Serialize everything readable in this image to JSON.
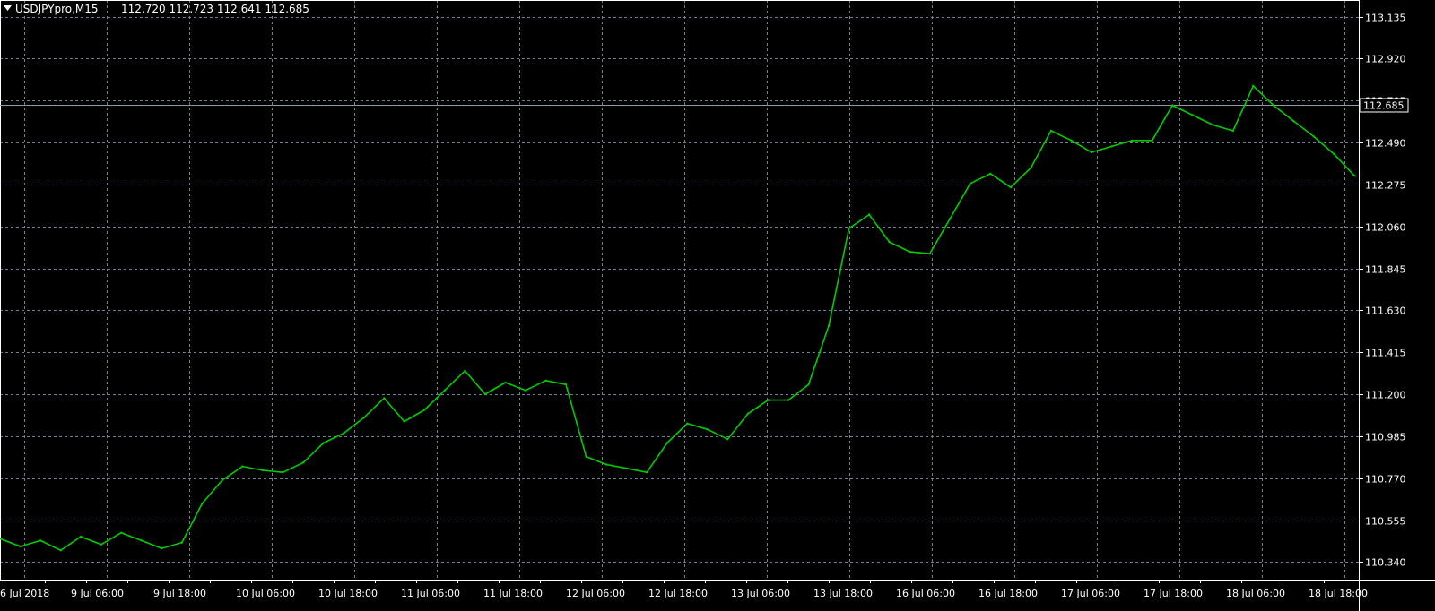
{
  "header": {
    "symbol": "USDJPYpro,M15",
    "ohlc": "112.720 112.723 112.641 112.685",
    "menu_icon": "triangle-down-icon"
  },
  "colors": {
    "background": "#000000",
    "series": "#00cc00",
    "grid": "#6e8094",
    "axis": "#ffffff",
    "current_price_line": "#8c9aa8"
  },
  "current_price": {
    "label": "112.685",
    "value": 112.685
  },
  "chart_data": {
    "type": "line",
    "title": "",
    "xlabel": "",
    "ylabel": "",
    "ylim": [
      110.25,
      113.22
    ],
    "grid": true,
    "y_ticks": [
      "113.135",
      "112.920",
      "112.705",
      "112.490",
      "112.275",
      "112.060",
      "111.845",
      "111.630",
      "111.415",
      "111.200",
      "110.985",
      "110.770",
      "110.555",
      "110.340"
    ],
    "x_ticks": [
      "6 Jul 2018",
      "9 Jul 06:00",
      "9 Jul 18:00",
      "10 Jul 06:00",
      "10 Jul 18:00",
      "11 Jul 06:00",
      "11 Jul 18:00",
      "12 Jul 06:00",
      "12 Jul 18:00",
      "13 Jul 06:00",
      "13 Jul 18:00",
      "16 Jul 06:00",
      "16 Jul 18:00",
      "17 Jul 06:00",
      "17 Jul 18:00",
      "18 Jul 06:00",
      "18 Jul 18:00"
    ],
    "series": [
      {
        "values": [
          110.46,
          110.42,
          110.45,
          110.4,
          110.47,
          110.43,
          110.49,
          110.45,
          110.41,
          110.44,
          110.64,
          110.76,
          110.83,
          110.81,
          110.8,
          110.85,
          110.95,
          111.0,
          111.08,
          111.18,
          111.06,
          111.12,
          111.22,
          111.32,
          111.2,
          111.26,
          111.22,
          111.27,
          111.25,
          110.88,
          110.84,
          110.82,
          110.8,
          110.95,
          111.05,
          111.02,
          110.97,
          111.1,
          111.17,
          111.17,
          111.25,
          111.55,
          112.05,
          112.12,
          111.98,
          111.93,
          111.92,
          112.1,
          112.28,
          112.33,
          112.26,
          112.36,
          112.55,
          112.5,
          112.44,
          112.47,
          112.5,
          112.5,
          112.68,
          112.63,
          112.58,
          112.55,
          112.78,
          112.68,
          112.6,
          112.52,
          112.43,
          112.32
        ]
      }
    ]
  }
}
